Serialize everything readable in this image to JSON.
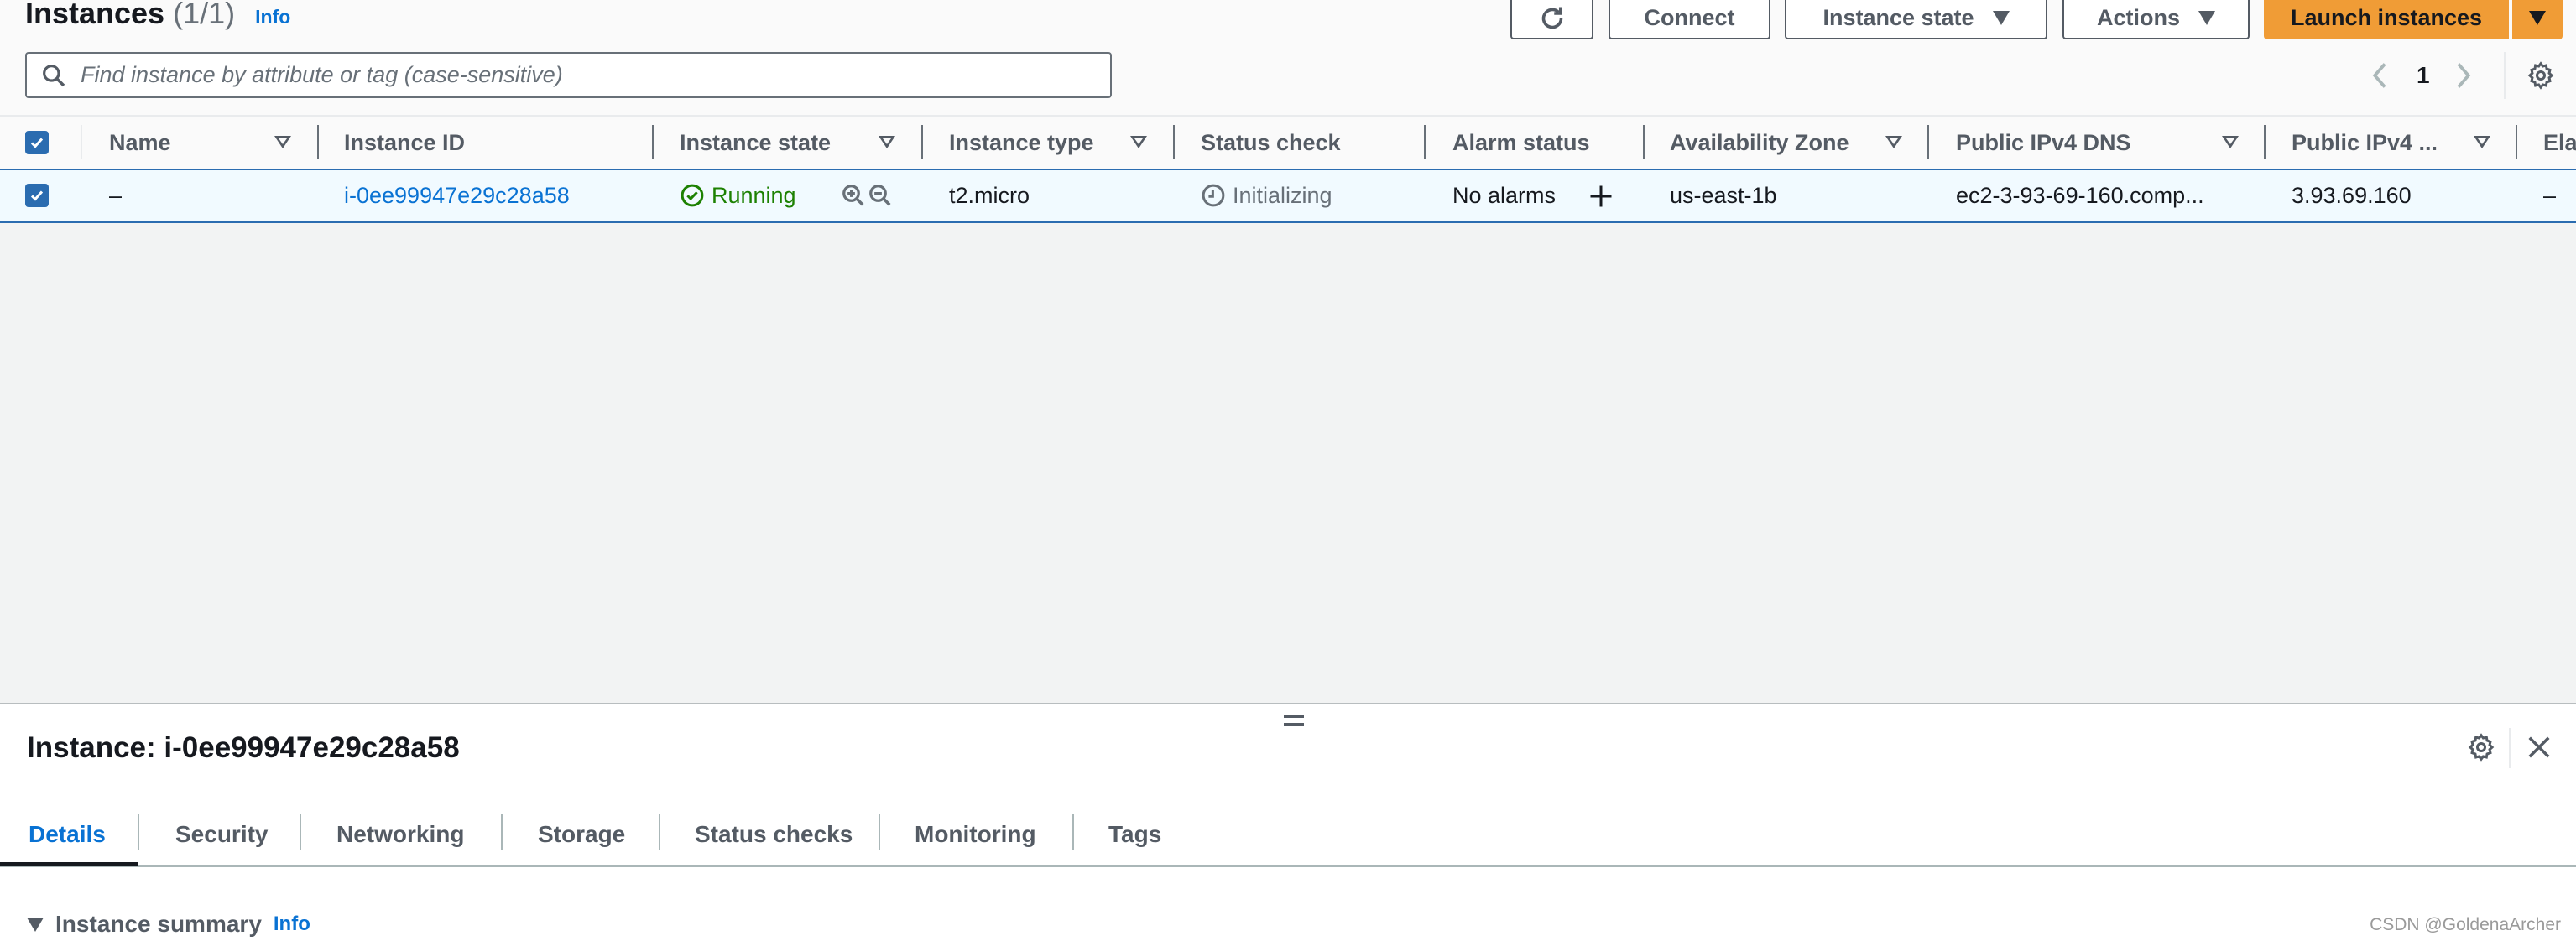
{
  "header": {
    "title": "Instances",
    "count": "(1/1)",
    "info": "Info"
  },
  "toolbar": {
    "refresh_icon": "refresh-icon",
    "connect": "Connect",
    "instance_state": "Instance state",
    "actions": "Actions",
    "launch": "Launch instances"
  },
  "search": {
    "placeholder": "Find instance by attribute or tag (case-sensitive)",
    "value": ""
  },
  "pagination": {
    "current_page": "1",
    "prev_icon": "chevron-left-icon",
    "next_icon": "chevron-right-icon",
    "settings_icon": "gear-icon"
  },
  "table": {
    "columns": [
      {
        "label": "Name",
        "sortable": true
      },
      {
        "label": "Instance ID",
        "sortable": false
      },
      {
        "label": "Instance state",
        "sortable": true
      },
      {
        "label": "Instance type",
        "sortable": true
      },
      {
        "label": "Status check",
        "sortable": false
      },
      {
        "label": "Alarm status",
        "sortable": false
      },
      {
        "label": "Availability Zone",
        "sortable": true
      },
      {
        "label": "Public IPv4 DNS",
        "sortable": true
      },
      {
        "label": "Public IPv4 ...",
        "sortable": true
      },
      {
        "label": "Ela",
        "sortable": false
      }
    ],
    "rows": [
      {
        "selected": true,
        "name": "–",
        "instance_id": "i-0ee99947e29c28a58",
        "instance_state": "Running",
        "instance_type": "t2.micro",
        "status_check": "Initializing",
        "alarm_status": "No alarms",
        "availability_zone": "us-east-1b",
        "public_dns": "ec2-3-93-69-160.comp...",
        "public_ip": "3.93.69.160",
        "elastic_ip": "–"
      }
    ]
  },
  "details": {
    "title": "Instance: i-0ee99947e29c28a58",
    "tabs": [
      "Details",
      "Security",
      "Networking",
      "Storage",
      "Status checks",
      "Monitoring",
      "Tags"
    ],
    "active_tab": "Details",
    "section_title": "Instance summary",
    "section_info": "Info"
  },
  "watermark": "CSDN @GoldenaArcher",
  "colors": {
    "primary": "#f09c36",
    "link": "#0972d3",
    "running": "#1d8102",
    "selected_row": "#f1faff",
    "selected_border": "#2b6cb0"
  }
}
